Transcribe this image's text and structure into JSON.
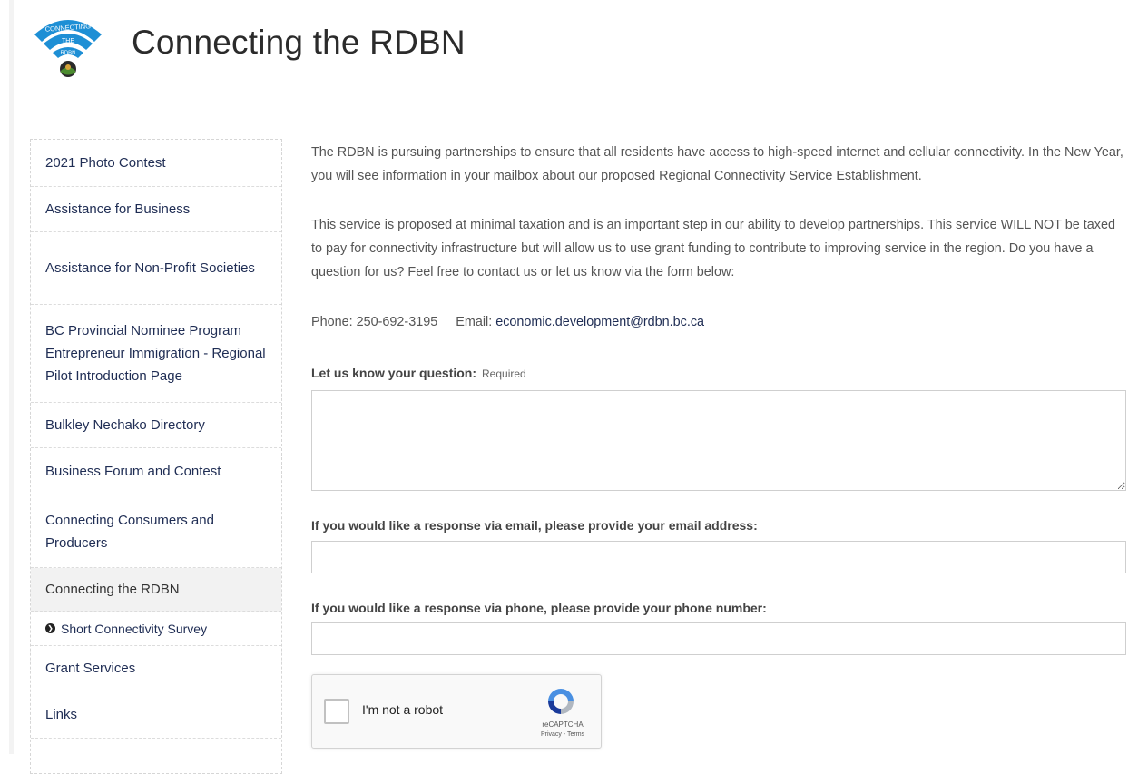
{
  "header": {
    "title": "Connecting the RDBN"
  },
  "logo": {
    "ring_top": "CONNECTING",
    "ring_mid": "THE",
    "ring_bot": "RDBN",
    "color": "#1e8fd5"
  },
  "sidebar": {
    "items": [
      {
        "label": "2021 Photo Contest"
      },
      {
        "label": "Assistance for Business"
      },
      {
        "label": "Assistance for Non-Profit Societies"
      },
      {
        "label": "BC Provincial Nominee Program Entrepreneur Immigration - Regional Pilot Introduction Page"
      },
      {
        "label": "Bulkley Nechako Directory"
      },
      {
        "label": "Business Forum and Contest"
      },
      {
        "label": "Connecting Consumers and Producers"
      },
      {
        "label": "Connecting the RDBN"
      },
      {
        "label": "Short Connectivity Survey"
      },
      {
        "label": "Grant Services"
      },
      {
        "label": "Links"
      }
    ]
  },
  "main": {
    "paragraph1": "The RDBN is pursuing partnerships to ensure that all residents have access to high-speed internet and cellular connectivity.  In the New Year, you will see information in your mailbox about our proposed Regional Connectivity Service Establishment.",
    "paragraph2": "This service is proposed at minimal taxation and is an important step in our ability to develop partnerships. This service WILL NOT be taxed to pay for connectivity infrastructure but will allow us to use grant funding to contribute to improving service in the region.   Do you have a question for us?  Feel free to contact us or let us know via the form below:",
    "phone_label": "Phone: 250-692-3195",
    "email_label": "Email:",
    "email": "economic.development@rdbn.bc.ca"
  },
  "form": {
    "question_label": "Let us know your question:",
    "required_label": "Required",
    "question_value": "",
    "email_label": "If you would like a response via email, please provide your email address:",
    "email_value": "",
    "phone_label": "If you would like a response via phone, please provide your phone number:",
    "phone_value": ""
  },
  "captcha": {
    "label": "I'm not a robot",
    "brand": "reCAPTCHA",
    "links": "Privacy - Terms"
  }
}
